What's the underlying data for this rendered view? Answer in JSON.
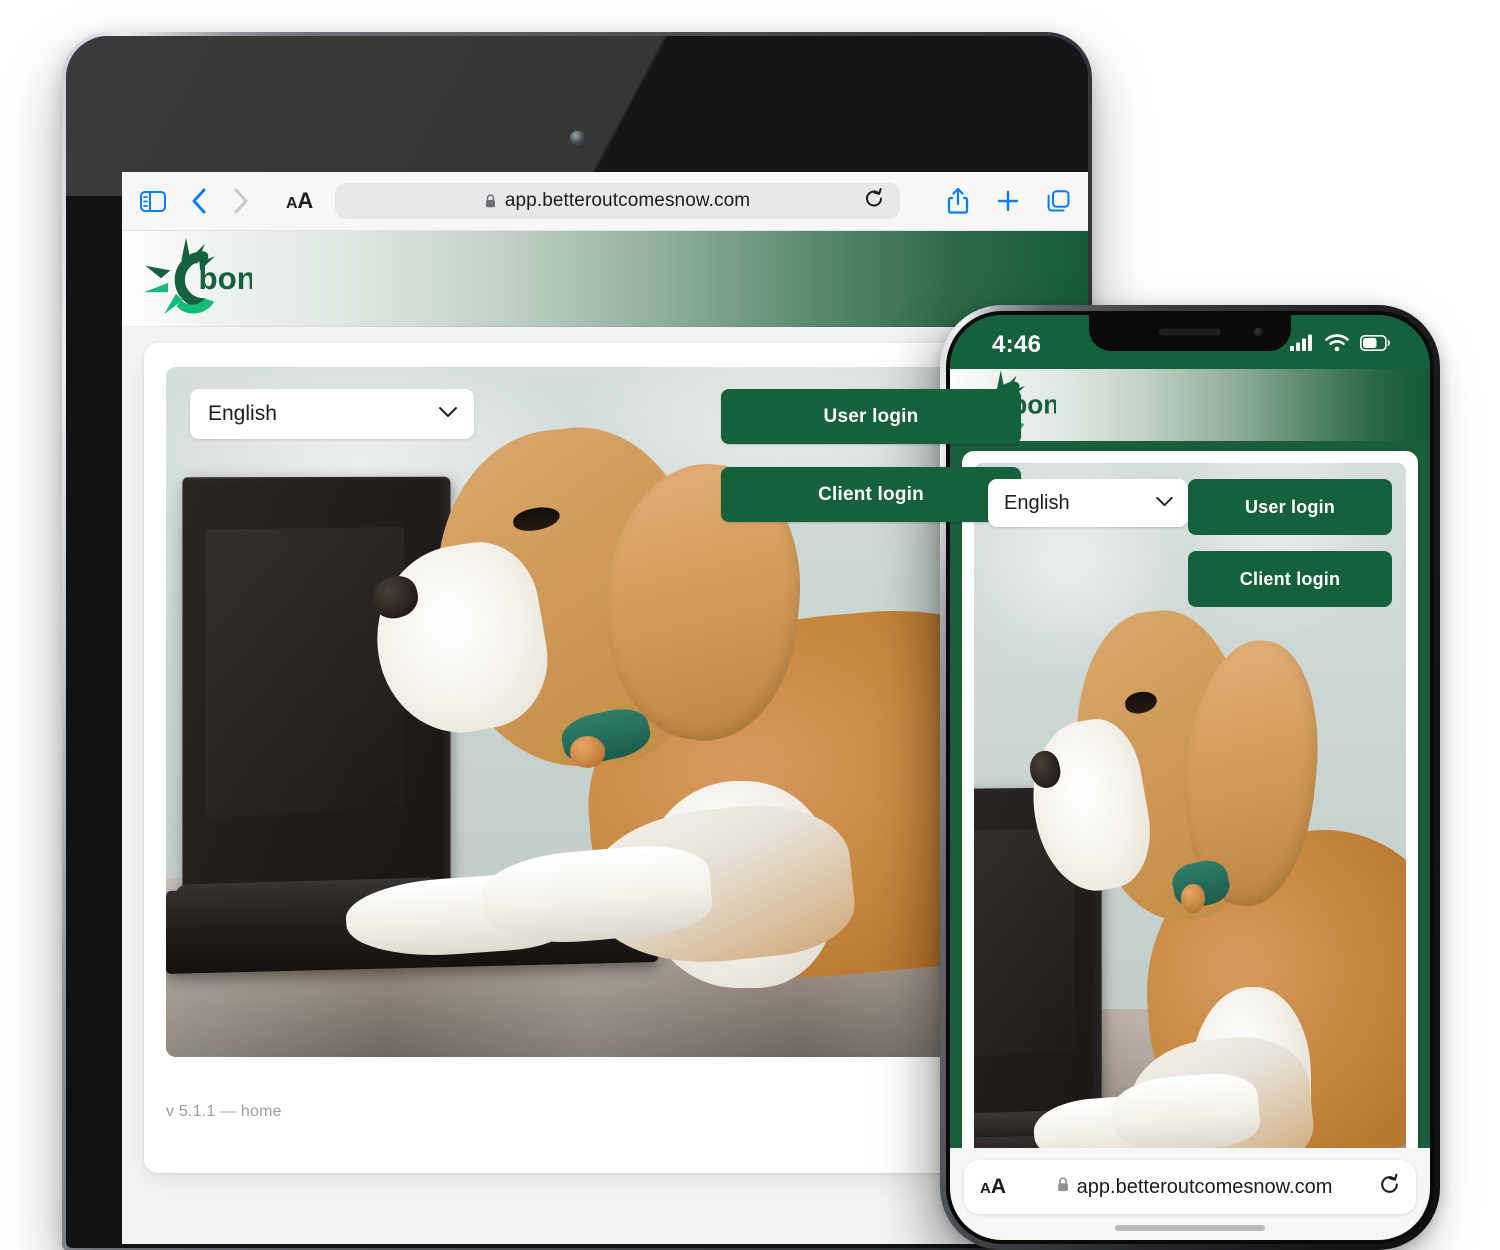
{
  "brand": {
    "name": "bon",
    "logo_icon": "sun-c-logo-icon",
    "colors": {
      "dark_green": "#15613d",
      "mid_green": "#1b7d55",
      "bright_green": "#17b978",
      "header_gradient_start": "#fdfefd",
      "header_gradient_end": "#155a37"
    }
  },
  "tablet": {
    "device": "tablet",
    "browser": {
      "sidebar_icon": "sidebar-icon",
      "back_icon": "chevron-left-icon",
      "forward_icon": "chevron-right-icon",
      "text_size_label_small": "A",
      "text_size_label_big": "A",
      "lock_icon": "lock-icon",
      "url": "app.betteroutcomesnow.com",
      "reload_icon": "reload-icon",
      "share_icon": "share-icon",
      "new_tab_icon": "plus-icon",
      "tabs_icon": "tabs-icon"
    },
    "page": {
      "language_select": {
        "value": "English",
        "chevron_icon": "chevron-down-icon"
      },
      "buttons": [
        {
          "label": "User login",
          "name": "user-login-button"
        },
        {
          "label": "Client login",
          "name": "client-login-button"
        }
      ],
      "hero_image_alt": "beagle dog lying at a laptop",
      "version": "v 5.1.1 — home"
    }
  },
  "phone": {
    "device": "phone",
    "status_bar": {
      "time": "4:46",
      "cellular_icon": "cellular-signal-icon",
      "wifi_icon": "wifi-icon",
      "battery_icon": "battery-icon"
    },
    "page": {
      "language_select": {
        "value": "English",
        "chevron_icon": "chevron-down-icon"
      },
      "buttons": [
        {
          "label": "User login",
          "name": "user-login-button"
        },
        {
          "label": "Client login",
          "name": "client-login-button"
        }
      ],
      "hero_image_alt": "beagle dog lying at a laptop"
    },
    "browser": {
      "text_size_label_small": "A",
      "text_size_label_big": "A",
      "lock_icon": "lock-icon",
      "url": "app.betteroutcomesnow.com",
      "reload_icon": "reload-icon"
    }
  }
}
